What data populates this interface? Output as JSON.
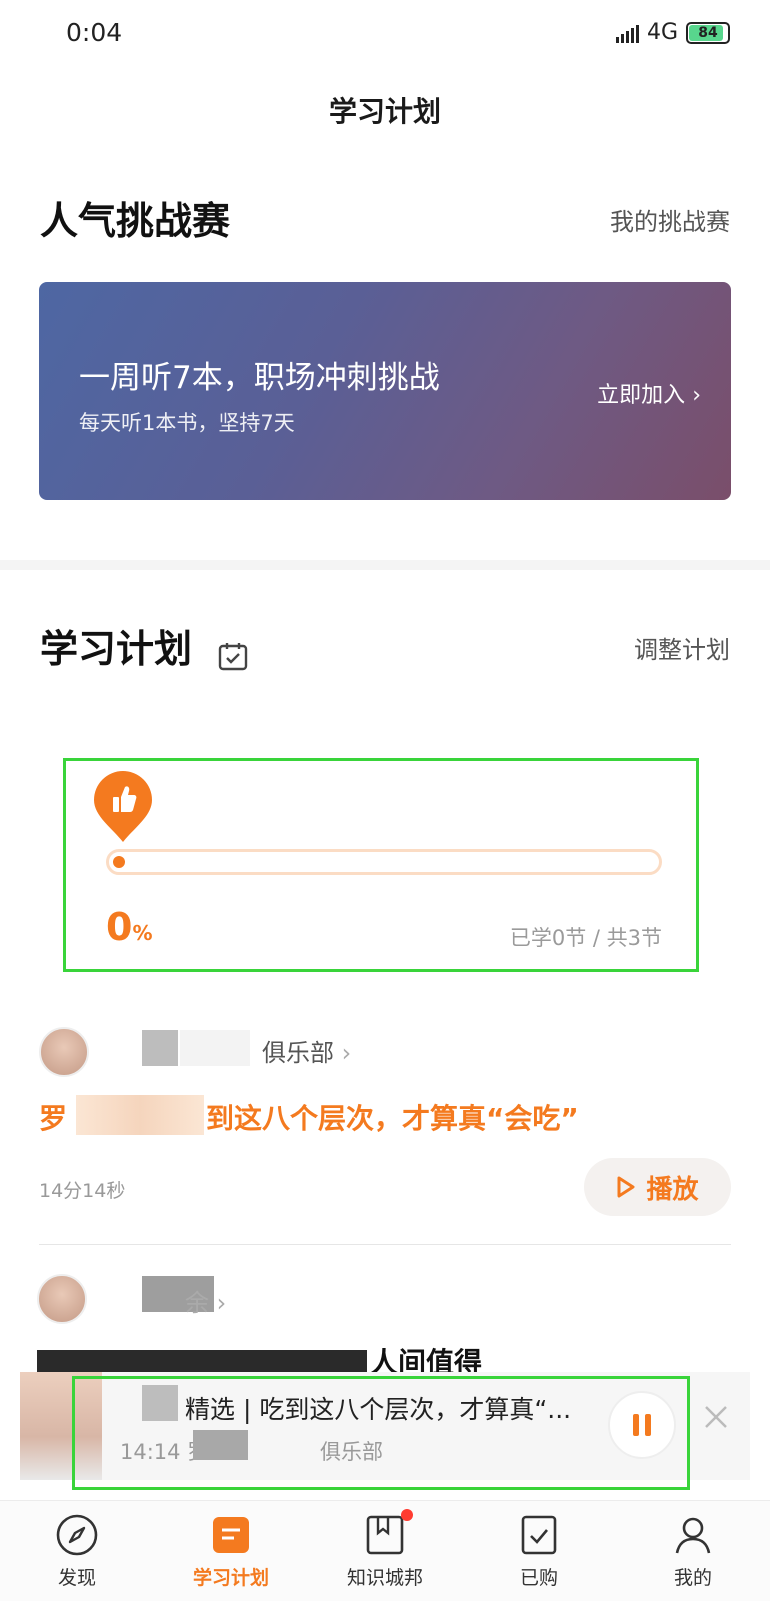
{
  "status_bar": {
    "time": "0:04",
    "network": "4G",
    "battery": "84"
  },
  "header": {
    "title": "学习计划"
  },
  "challenges": {
    "title": "人气挑战赛",
    "link": "我的挑战赛",
    "card": {
      "title": "一周听7本，职场冲刺挑战",
      "subtitle": "每天听1本书，坚持7天",
      "action": "立即加入",
      "gradient": [
        "#4e67a3",
        "#7a4e6a"
      ]
    }
  },
  "plan": {
    "title": "学习计划",
    "link": "调整计划",
    "progress": {
      "percent": 0,
      "percent_text": "0",
      "unit": "%",
      "summary": "已学0节 / 共3节"
    }
  },
  "items": [
    {
      "club": "俱乐部",
      "title": "罗",
      "title_rest": "到这八个层次，才算真“会吃”",
      "duration": "14分14秒",
      "play_label": "播放"
    },
    {
      "club": "余",
      "title": "人间值得"
    }
  ],
  "player": {
    "title": "精选 | 吃到这八个层次，才算真“...",
    "time": "14:14",
    "author_prefix": "罗",
    "club": "俱乐部"
  },
  "tabs": [
    {
      "label": "发现",
      "icon": "compass-icon"
    },
    {
      "label": "学习计划",
      "icon": "plan-icon",
      "active": true
    },
    {
      "label": "知识城邦",
      "icon": "bookmark-icon",
      "badge": true
    },
    {
      "label": "已购",
      "icon": "checked-doc-icon"
    },
    {
      "label": "我的",
      "icon": "profile-icon"
    }
  ],
  "colors": {
    "accent": "#f47a1f",
    "highlight_box": "#39d43a"
  }
}
